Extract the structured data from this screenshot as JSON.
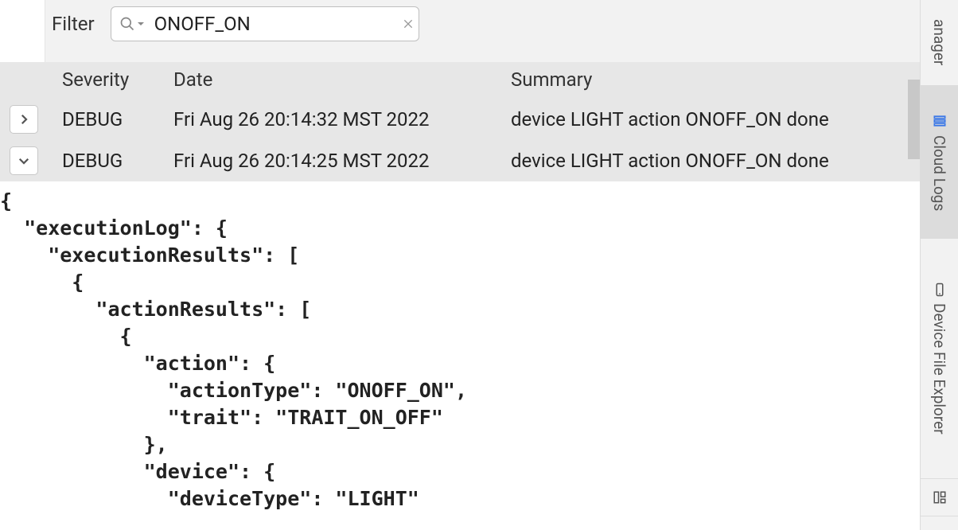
{
  "filter": {
    "label": "Filter",
    "value": "ONOFF_ON",
    "placeholder": ""
  },
  "columns": {
    "severity": "Severity",
    "date": "Date",
    "summary": "Summary"
  },
  "rows": [
    {
      "expanded": false,
      "severity": "DEBUG",
      "date": "Fri Aug 26 20:14:32 MST 2022",
      "summary": "device LIGHT action ONOFF_ON done"
    },
    {
      "expanded": true,
      "severity": "DEBUG",
      "date": "Fri Aug 26 20:14:25 MST 2022",
      "summary": "device LIGHT action ONOFF_ON done"
    }
  ],
  "detail_json": "{\n  \"executionLog\": {\n    \"executionResults\": [\n      {\n        \"actionResults\": [\n          {\n            \"action\": {\n              \"actionType\": \"ONOFF_ON\",\n              \"trait\": \"TRAIT_ON_OFF\"\n            },\n            \"device\": {\n              \"deviceType\": \"LIGHT\"",
  "side_tabs": {
    "manager": "anager",
    "cloud_logs": "Cloud Logs",
    "device_file_explorer": "Device File Explorer"
  }
}
